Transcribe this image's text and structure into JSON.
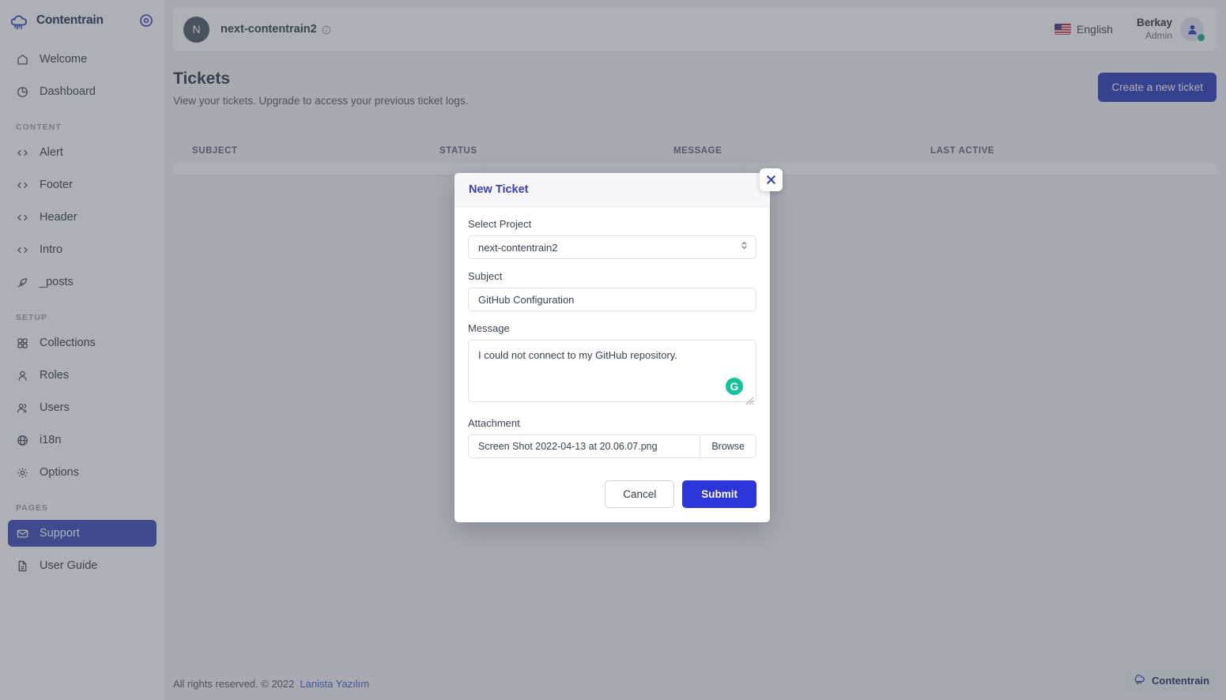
{
  "brand": {
    "name": "Contentrain",
    "logo_icon": "cloud-logo-icon",
    "toggle_icon": "sidebar-toggle-icon"
  },
  "sidebar": {
    "top_items": [
      {
        "label": "Welcome",
        "icon": "home-icon"
      },
      {
        "label": "Dashboard",
        "icon": "pie-chart-icon"
      }
    ],
    "sections": [
      {
        "title": "CONTENT",
        "items": [
          {
            "label": "Alert",
            "icon": "code-icon"
          },
          {
            "label": "Footer",
            "icon": "code-icon"
          },
          {
            "label": "Header",
            "icon": "code-icon"
          },
          {
            "label": "Intro",
            "icon": "code-icon"
          },
          {
            "label": "_posts",
            "icon": "feather-icon"
          }
        ]
      },
      {
        "title": "SETUP",
        "items": [
          {
            "label": "Collections",
            "icon": "grid-icon"
          },
          {
            "label": "Roles",
            "icon": "user-icon"
          },
          {
            "label": "Users",
            "icon": "users-icon"
          },
          {
            "label": "i18n",
            "icon": "globe-icon"
          },
          {
            "label": "Options",
            "icon": "gear-icon"
          }
        ]
      },
      {
        "title": "PAGES",
        "items": [
          {
            "label": "Support",
            "icon": "mail-icon",
            "active": true
          },
          {
            "label": "User Guide",
            "icon": "document-icon",
            "active": false
          }
        ]
      }
    ]
  },
  "topbar": {
    "project_initial": "N",
    "project_name": "next-contentrain2",
    "info_icon": "info-icon",
    "language": "English",
    "flag_icon": "us-flag-icon",
    "user_name": "Berkay",
    "user_role": "Admin",
    "avatar_icon": "user-avatar-icon",
    "status": "online"
  },
  "page": {
    "title": "Tickets",
    "subtitle": "View your tickets. Upgrade to access your previous ticket logs.",
    "create_button": "Create a new ticket"
  },
  "table": {
    "columns": [
      "SUBJECT",
      "STATUS",
      "MESSAGE",
      "LAST ACTIVE"
    ],
    "rows": []
  },
  "modal": {
    "title": "New Ticket",
    "close_icon": "close-icon",
    "project_label": "Select Project",
    "project_value": "next-contentrain2",
    "project_options": [
      "next-contentrain2"
    ],
    "subject_label": "Subject",
    "subject_value": "GitHub Configuration",
    "message_label": "Message",
    "message_value": "I could not connect to my GitHub repository.",
    "grammarly_badge": "G",
    "attachment_label": "Attachment",
    "attachment_value": "Screen Shot 2022-04-13 at 20.06.07.png",
    "browse_button": "Browse",
    "cancel_button": "Cancel",
    "submit_button": "Submit"
  },
  "footer": {
    "text": "All rights reserved. © 2022",
    "link": "Lanista Yazılım",
    "watermark": "Contentrain"
  },
  "colors": {
    "brand_indigo": "#3b46b4",
    "primary_blue": "#2b35b8",
    "submit_blue": "#2b35d8",
    "modal_title": "#3b3fb6",
    "link_blue": "#3d50d6",
    "grammarly_green": "#15c39a",
    "status_green": "#1aa97a"
  }
}
